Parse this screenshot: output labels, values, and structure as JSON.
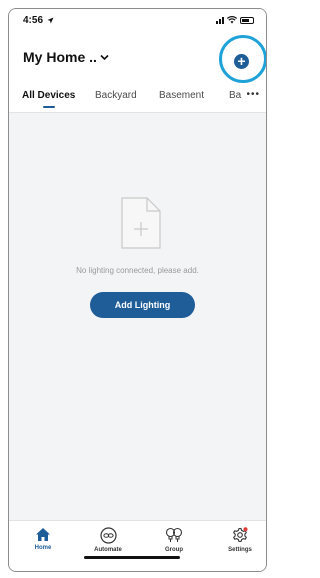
{
  "status_bar": {
    "time": "4:56"
  },
  "header": {
    "home_name": "My Home ..",
    "add_icon": "plus-circle-icon"
  },
  "tabs": [
    {
      "label": "All Devices",
      "active": true
    },
    {
      "label": "Backyard",
      "active": false
    },
    {
      "label": "Basement",
      "active": false
    },
    {
      "label": "Ba",
      "active": false
    }
  ],
  "tabs_more": "•••",
  "empty_state": {
    "message": "No lighting connected, please add.",
    "button_label": "Add Lighting"
  },
  "bottom_nav": [
    {
      "label": "Home",
      "icon": "home-icon",
      "active": true
    },
    {
      "label": "Automate",
      "icon": "automate-icon",
      "active": false
    },
    {
      "label": "Group",
      "icon": "group-bulbs-icon",
      "active": false
    },
    {
      "label": "Settings",
      "icon": "settings-gear-icon",
      "active": false
    }
  ],
  "colors": {
    "accent": "#1f5d99",
    "highlight": "#1fa2d8",
    "notification_dot": "#e53935"
  }
}
